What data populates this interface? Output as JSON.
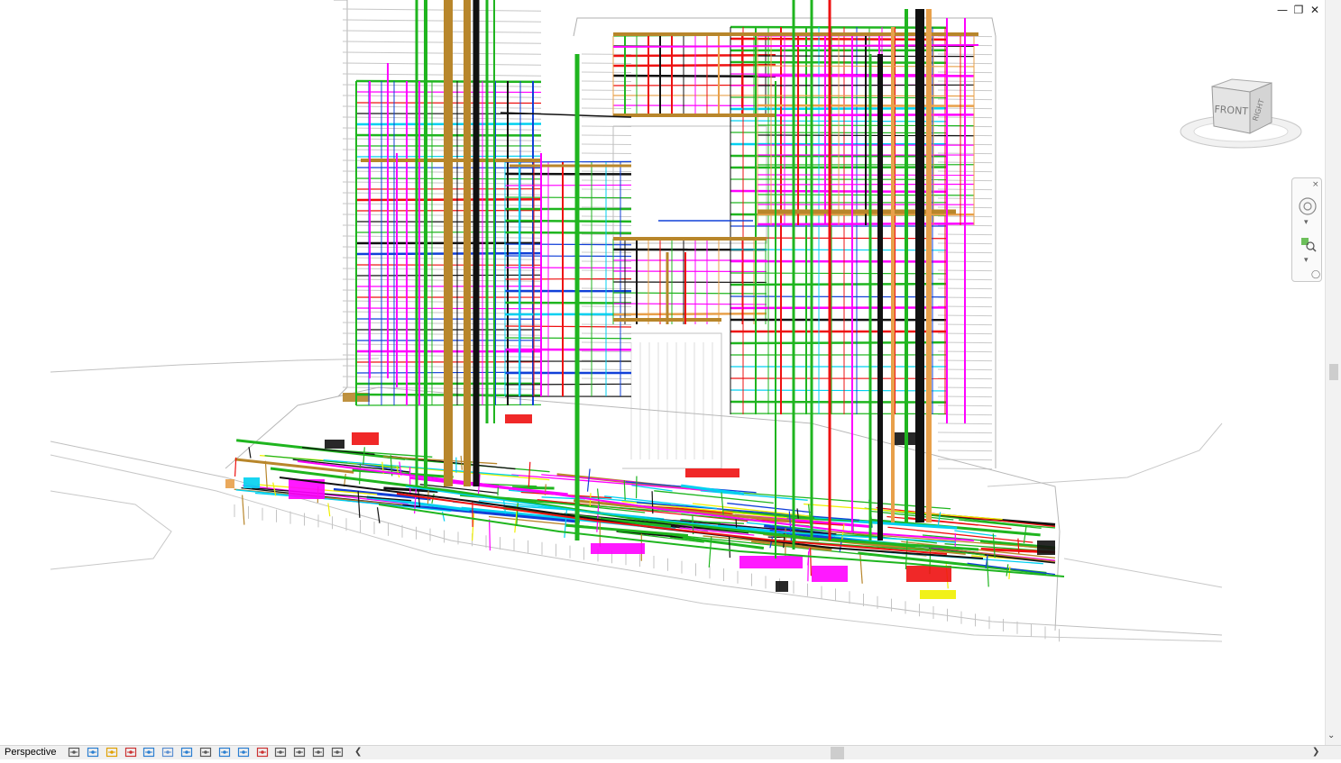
{
  "view": {
    "label": "Perspective",
    "type": "3D BIM MEP coordination model"
  },
  "window_controls": {
    "minimize_icon": "minimize-icon",
    "restore_icon": "restore-icon",
    "close_icon": "close-icon"
  },
  "viewcube": {
    "front_label": "FRONT",
    "right_label": "RIGHT"
  },
  "navigation_bar": {
    "items": [
      "steering-wheel-icon",
      "zoom-region-icon"
    ]
  },
  "view_control_bar": {
    "icons": [
      "scale-icon",
      "detail-level-icon",
      "visual-style-icon",
      "sun-path-icon",
      "shadows-icon",
      "render-icon",
      "crop-view-icon",
      "show-crop-region-icon",
      "unlock-3d-view-icon",
      "temporary-hide-isolate-icon",
      "reveal-hidden-elements-icon",
      "temporary-view-properties-icon",
      "worksharing-display-icon",
      "analytical-model-icon",
      "highlight-displacement-icon",
      "reveal-constraints-icon"
    ]
  },
  "colors": {
    "plumbing_green": "#1fb51f",
    "hvac_magenta": "#ff00ff",
    "fire_red": "#ee1111",
    "cable_tray_brown": "#b8862b",
    "duct_orange": "#e8a04a",
    "drainage_black": "#111111",
    "chilled_water_cyan": "#00d0f0",
    "electrical_blue": "#1140d8",
    "gas_yellow": "#f0f000",
    "architecture_grey": "#9a9a9a"
  }
}
